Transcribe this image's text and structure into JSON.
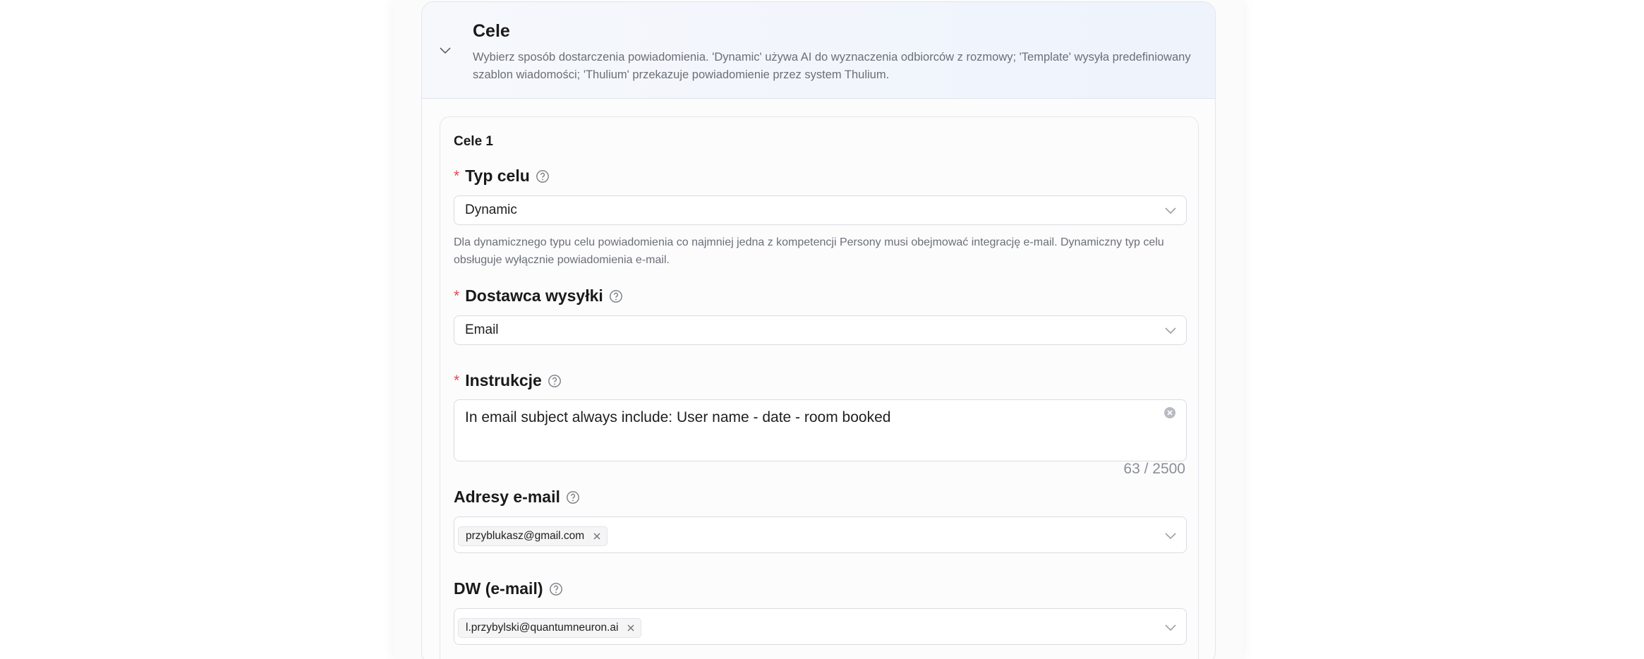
{
  "section": {
    "title": "Cele",
    "description": "Wybierz sposób dostarczenia powiadomienia. 'Dynamic' używa AI do wyznaczenia odbiorców z rozmowy; 'Template' wysyła predefiniowany szablon wiadomości; 'Thulium' przekazuje powiadomienie przez system Thulium."
  },
  "target": {
    "title": "Cele 1",
    "type_field": {
      "label": "Typ celu",
      "required": "*",
      "value": "Dynamic",
      "hint": "Dla dynamicznego typu celu powiadomienia co najmniej jedna z kompetencji Persony musi obejmować integrację e-mail. Dynamiczny typ celu obsługuje wyłącznie powiadomienia e-mail."
    },
    "provider_field": {
      "label": "Dostawca wysyłki",
      "required": "*",
      "value": "Email"
    },
    "instructions_field": {
      "label": "Instrukcje",
      "required": "*",
      "value": "In email subject always include: User name - date - room booked",
      "counter": "63 / 2500"
    },
    "emails_field": {
      "label": "Adresy e-mail",
      "tags": [
        "przyblukasz@gmail.com"
      ]
    },
    "cc_field": {
      "label": "DW (e-mail)",
      "tags": [
        "l.przybylski@quantumneuron.ai"
      ]
    }
  },
  "colors": {
    "required": "#e5484d",
    "header_bg": "#eef3fc",
    "muted_text": "#6b6f76",
    "border": "#d9dce1"
  },
  "icons": {
    "collapse": "chevron-down-icon",
    "help": "question-circle-icon",
    "select_arrow": "chevron-down-icon",
    "clear": "close-circle-icon",
    "tag_remove": "close-icon"
  }
}
